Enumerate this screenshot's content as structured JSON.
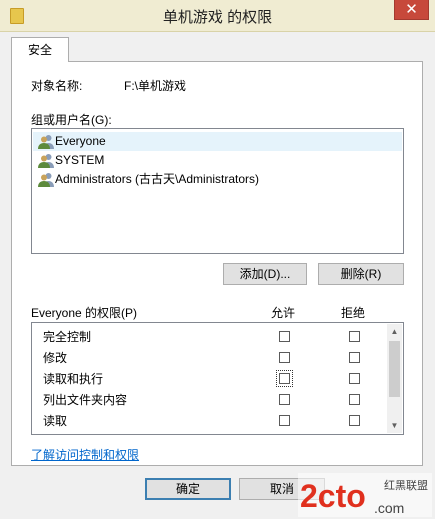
{
  "window": {
    "title": "单机游戏 的权限",
    "close_label": "✕"
  },
  "tabs": [
    {
      "label": "安全"
    }
  ],
  "object_name": {
    "label": "对象名称:",
    "value": "F:\\单机游戏"
  },
  "groups": {
    "label": "组或用户名(G):",
    "items": [
      {
        "label": "Everyone"
      },
      {
        "label": "SYSTEM"
      },
      {
        "label": "Administrators (古古天\\Administrators)"
      }
    ],
    "add_button": "添加(D)...",
    "remove_button": "删除(R)"
  },
  "permissions": {
    "label": "Everyone 的权限(P)",
    "allow_header": "允许",
    "deny_header": "拒绝",
    "rows": [
      {
        "label": "完全控制",
        "allow": false,
        "deny": false
      },
      {
        "label": "修改",
        "allow": false,
        "deny": false
      },
      {
        "label": "读取和执行",
        "allow": false,
        "deny": false
      },
      {
        "label": "列出文件夹内容",
        "allow": false,
        "deny": false
      },
      {
        "label": "读取",
        "allow": false,
        "deny": false
      }
    ]
  },
  "link": "了解访问控制和权限",
  "footer": {
    "ok_button": "确定",
    "cancel_button": "取消"
  },
  "watermark": {
    "text": "2cto",
    "suffix": ".com",
    "side_text": "红黑联盟"
  },
  "colors": {
    "titlebar": "#f0ecd2",
    "close": "#c7493b",
    "selection": "#e5f3fb",
    "link": "#0066cc",
    "watermark": "#e0301e"
  }
}
